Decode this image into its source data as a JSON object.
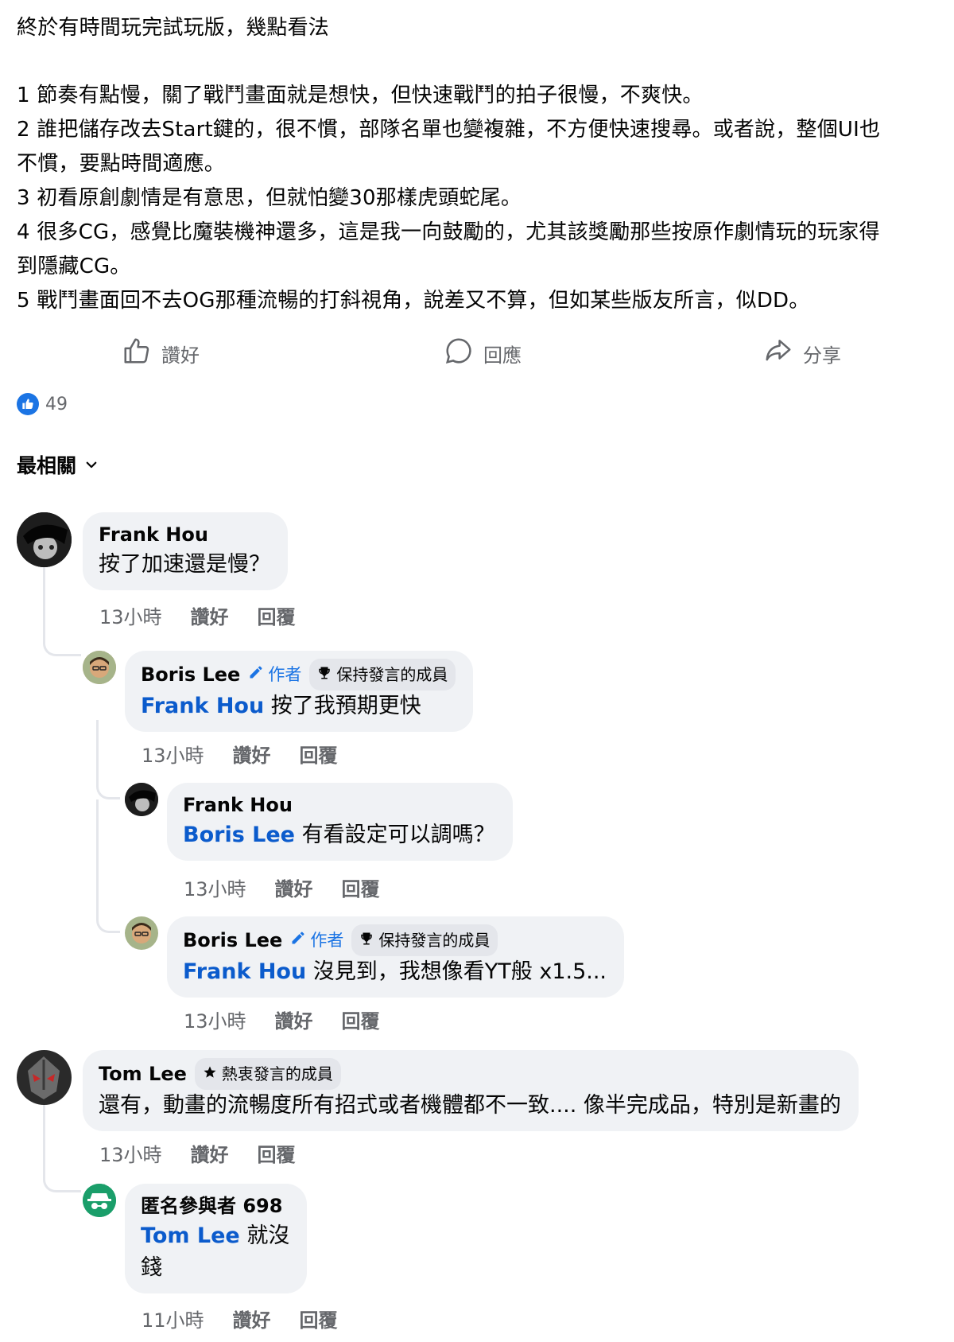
{
  "post": {
    "title": "終於有時間玩完試玩版，幾點看法",
    "points": [
      "1 節奏有點慢，關了戰鬥畫面就是想快，但快速戰鬥的拍子很慢，不爽快。",
      "2 誰把儲存改去Start鍵的，很不慣，部隊名單也變複雜，不方便快速搜尋。或者說，整個UI也",
      "不慣，要點時間適應。",
      "3 初看原創劇情是有意思，但就怕變30那樣虎頭蛇尾。",
      "4 很多CG，感覺比魔裝機神還多，這是我一向鼓勵的，尤其該獎勵那些按原作劇情玩的玩家得",
      "到隱藏CG。",
      "5 戰鬥畫面回不去OG那種流暢的打斜視角，說差又不算，但如某些版友所言，似DD。"
    ]
  },
  "actions": {
    "like": "讚好",
    "reply": "回應",
    "share": "分享"
  },
  "reactions": {
    "count": "49"
  },
  "sort": {
    "label": "最相關"
  },
  "comments": [
    {
      "name": "Frank Hou",
      "text": "按了加速還是慢？",
      "time": "13小時",
      "like": "讚好",
      "reply": "回覆"
    },
    {
      "name": "Boris Lee",
      "author_tag": "作者",
      "badge": "保持發言的成員",
      "mention": "Frank Hou",
      "text": " 按了我預期更快",
      "time": "13小時",
      "like": "讚好",
      "reply": "回覆"
    },
    {
      "name": "Frank Hou",
      "mention": "Boris Lee",
      "text": " 有看設定可以調嗎？",
      "time": "13小時",
      "like": "讚好",
      "reply": "回覆"
    },
    {
      "name": "Boris Lee",
      "author_tag": "作者",
      "badge": "保持發言的成員",
      "mention": "Frank Hou",
      "text": " 沒見到，我想像看YT般 x1.5...",
      "time": "13小時",
      "like": "讚好",
      "reply": "回覆"
    },
    {
      "name": "Tom Lee",
      "badge": "熱衷發言的成員",
      "text": "還有，動畫的流暢度所有招式或者機體都不一致.... 像半完成品，特別是新畫的",
      "time": "13小時",
      "like": "讚好",
      "reply": "回覆"
    },
    {
      "name": "匿名參與者 698",
      "mention": "Tom Lee",
      "text": " 就沒",
      "text2": "錢",
      "time": "11小時",
      "like": "讚好",
      "reply": "回覆"
    }
  ],
  "colors": {
    "link": "#0b5bcc",
    "accent": "#1b74e4",
    "bubble": "#f0f2f5",
    "muted": "#65676b",
    "anon": "#1a9e6a"
  }
}
